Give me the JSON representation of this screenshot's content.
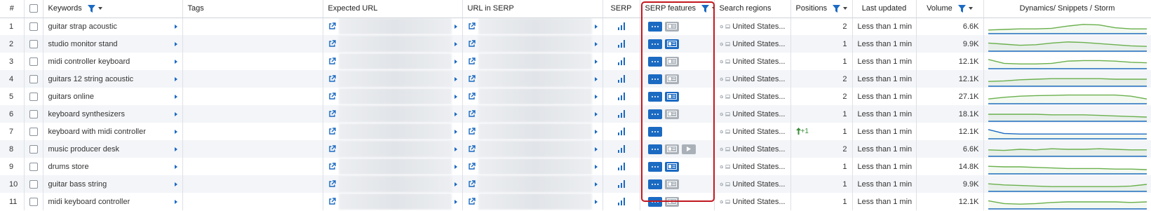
{
  "headers": {
    "num": "#",
    "keywords": "Keywords",
    "tags": "Tags",
    "expected_url": "Expected URL",
    "url_in_serp": "URL in SERP",
    "serp": "SERP",
    "serp_features": "SERP features",
    "search_regions": "Search regions",
    "positions": "Positions",
    "last_updated": "Last updated",
    "volume": "Volume",
    "dynamics": "Dynamics/ Snippets / Storm"
  },
  "colors": {
    "accent": "#1b6ac2",
    "highlight": "#c2181f",
    "spark_green": "#6ab04c",
    "spark_blue": "#1b6ac2",
    "up_arrow": "#3a8f3a"
  },
  "rows": [
    {
      "num": "1",
      "keyword": "guitar strap acoustic",
      "features": [
        "dots",
        "card-grey"
      ],
      "region": "United States...",
      "delta": "",
      "position": "2",
      "updated": "Less than 1 min",
      "volume": "6.6K",
      "spark": [
        0.2,
        0.25,
        0.3,
        0.3,
        0.35,
        0.55,
        0.7,
        0.65,
        0.4,
        0.3,
        0.3
      ]
    },
    {
      "num": "2",
      "keyword": "studio monitor stand",
      "features": [
        "dots",
        "card"
      ],
      "region": "United States...",
      "delta": "",
      "position": "1",
      "updated": "Less than 1 min",
      "volume": "9.9K",
      "spark": [
        0.6,
        0.5,
        0.4,
        0.45,
        0.6,
        0.7,
        0.65,
        0.55,
        0.45,
        0.35,
        0.3
      ]
    },
    {
      "num": "3",
      "keyword": "midi controller keyboard",
      "features": [
        "dots",
        "card-grey"
      ],
      "region": "United States...",
      "delta": "",
      "position": "1",
      "updated": "Less than 1 min",
      "volume": "12.1K",
      "spark": [
        0.7,
        0.35,
        0.3,
        0.3,
        0.35,
        0.55,
        0.6,
        0.6,
        0.55,
        0.45,
        0.4
      ]
    },
    {
      "num": "4",
      "keyword": "guitars 12 string acoustic",
      "features": [
        "dots",
        "card-grey"
      ],
      "region": "United States...",
      "delta": "",
      "position": "2",
      "updated": "Less than 1 min",
      "volume": "12.1K",
      "spark": [
        0.3,
        0.35,
        0.45,
        0.5,
        0.55,
        0.55,
        0.55,
        0.55,
        0.5,
        0.5,
        0.5
      ]
    },
    {
      "num": "5",
      "keyword": "guitars online",
      "features": [
        "dots",
        "card"
      ],
      "region": "United States...",
      "delta": "",
      "position": "2",
      "updated": "Less than 1 min",
      "volume": "27.1K",
      "spark": [
        0.3,
        0.45,
        0.55,
        0.6,
        0.62,
        0.65,
        0.65,
        0.65,
        0.65,
        0.55,
        0.3
      ]
    },
    {
      "num": "6",
      "keyword": "keyboard synthesizers",
      "features": [
        "dots",
        "card-grey"
      ],
      "region": "United States...",
      "delta": "",
      "position": "1",
      "updated": "Less than 1 min",
      "volume": "18.1K",
      "spark": [
        0.5,
        0.5,
        0.5,
        0.5,
        0.45,
        0.45,
        0.45,
        0.4,
        0.35,
        0.3,
        0.25
      ]
    },
    {
      "num": "7",
      "keyword": "keyboard with midi controller",
      "features": [
        "dots"
      ],
      "region": "United States...",
      "delta": "+1",
      "position": "1",
      "updated": "Less than 1 min",
      "volume": "12.1K",
      "spark": [
        0.7,
        0.35,
        0.3,
        0.3,
        0.3,
        0.3,
        0.3,
        0.3,
        0.3,
        0.3,
        0.3
      ]
    },
    {
      "num": "8",
      "keyword": "music producer desk",
      "features": [
        "dots",
        "card-grey",
        "play"
      ],
      "region": "United States...",
      "delta": "",
      "position": "2",
      "updated": "Less than 1 min",
      "volume": "6.6K",
      "spark": [
        0.45,
        0.4,
        0.5,
        0.45,
        0.55,
        0.5,
        0.5,
        0.55,
        0.5,
        0.45,
        0.45
      ]
    },
    {
      "num": "9",
      "keyword": "drums store",
      "features": [
        "dots",
        "card"
      ],
      "region": "United States...",
      "delta": "",
      "position": "1",
      "updated": "Less than 1 min",
      "volume": "14.8K",
      "spark": [
        0.55,
        0.5,
        0.5,
        0.45,
        0.4,
        0.35,
        0.35,
        0.35,
        0.3,
        0.3,
        0.25
      ]
    },
    {
      "num": "10",
      "keyword": "guitar bass string",
      "features": [
        "dots",
        "card-grey"
      ],
      "region": "United States...",
      "delta": "",
      "position": "1",
      "updated": "Less than 1 min",
      "volume": "9.9K",
      "spark": [
        0.55,
        0.45,
        0.4,
        0.35,
        0.3,
        0.3,
        0.3,
        0.3,
        0.3,
        0.35,
        0.5
      ]
    },
    {
      "num": "11",
      "keyword": "midi keyboard controller",
      "features": [
        "dots",
        "card-grey"
      ],
      "region": "United States...",
      "delta": "",
      "position": "1",
      "updated": "Less than 1 min",
      "volume": "12.1K",
      "spark": [
        0.6,
        0.35,
        0.3,
        0.35,
        0.45,
        0.5,
        0.5,
        0.5,
        0.5,
        0.45,
        0.5
      ]
    }
  ]
}
